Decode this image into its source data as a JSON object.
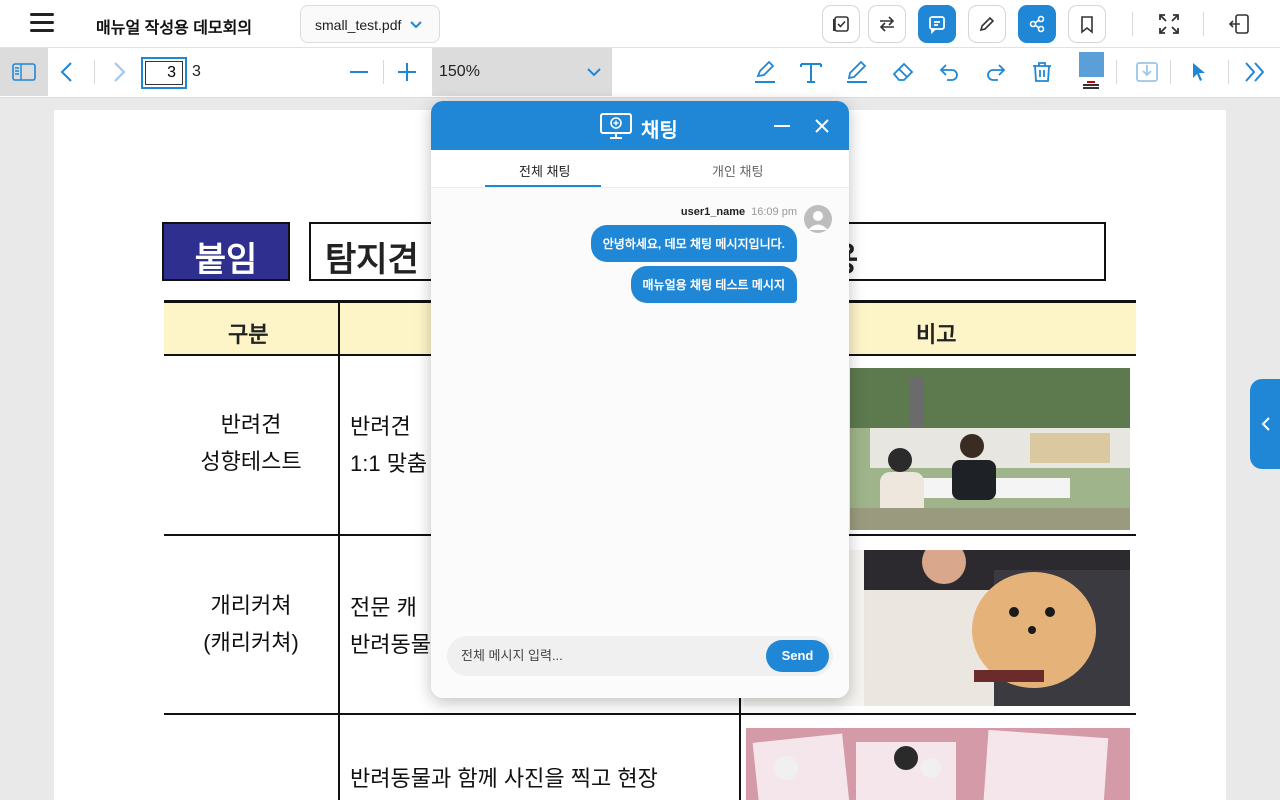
{
  "header": {
    "app_title": "매뉴얼 작성용 데모회의",
    "file_name": "small_test.pdf",
    "icons": [
      "task-check-icon",
      "swap-icon",
      "chat-icon",
      "pen-icon",
      "share-icon",
      "bookmark-icon",
      "fullscreen-icon",
      "exit-icon"
    ],
    "accent_color": "#1f87d6"
  },
  "toolbar": {
    "current_page": "3",
    "total_pages": "3",
    "zoom": "150%",
    "current_color": "#5b9fd8"
  },
  "document": {
    "badge": "붙임",
    "title_start": "탐지견",
    "title_end": "용",
    "headers": [
      "구분",
      "비고"
    ],
    "rows": [
      {
        "category_line1": "반려견",
        "category_line2": "성향테스트",
        "desc_line1": "반려견",
        "desc_line2": "1:1  맞춤"
      },
      {
        "category_line1": "개리커쳐",
        "category_line2": "(캐리커쳐)",
        "desc_line1": "전문  캐",
        "desc_line2": "반려동물"
      },
      {
        "category_line1": "",
        "category_line2": "",
        "desc_line1": "반려동물과  함께  사진을  찍고  현장",
        "desc_line2": ""
      }
    ]
  },
  "chat": {
    "title": "채팅",
    "tabs": [
      "전체 채팅",
      "개인 채팅"
    ],
    "active_tab": "전체 채팅",
    "messages": {
      "user": "user1_name",
      "time": "16:09 pm",
      "texts": [
        "안녕하세요, 데모 채팅 메시지입니다.",
        "매뉴얼용 채팅 테스트 메시지"
      ]
    },
    "input_placeholder": "전체 메시지 입력...",
    "send_label": "Send"
  }
}
